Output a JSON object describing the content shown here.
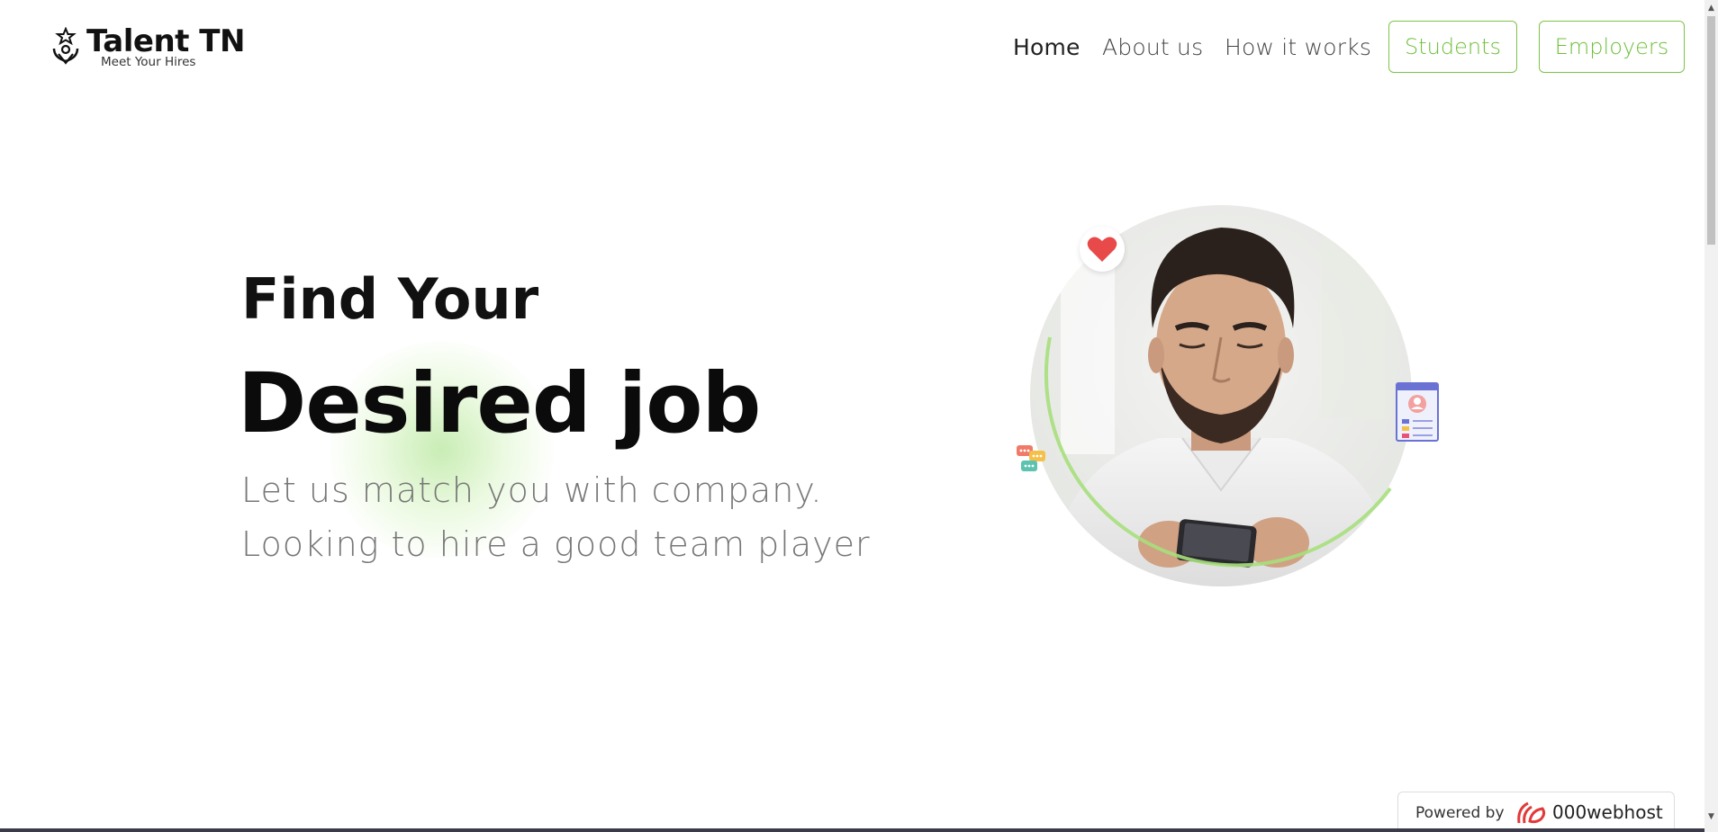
{
  "brand": {
    "title": "Talent TN",
    "tagline": "Meet Your Hires"
  },
  "nav": {
    "links": [
      {
        "label": "Home",
        "active": true
      },
      {
        "label": "About us",
        "active": false
      },
      {
        "label": "How it works",
        "active": false
      }
    ],
    "buttons": [
      {
        "label": "Students"
      },
      {
        "label": "Employers"
      }
    ]
  },
  "hero": {
    "line1": "Find Your",
    "line2": "Desired job",
    "subtitle1": "Let us match you with company.",
    "subtitle2": "Looking to hire a good team player"
  },
  "decor": {
    "heart_icon": "heart-icon",
    "chat_icon": "chat-bubbles-icon",
    "profile_icon": "profile-document-icon"
  },
  "footer": {
    "powered_label": "Powered by",
    "powered_brand": "000webhost"
  },
  "colors": {
    "accent": "#7dc44a",
    "heart": "#e84a4a",
    "text": "#111111",
    "muted": "#777777"
  }
}
